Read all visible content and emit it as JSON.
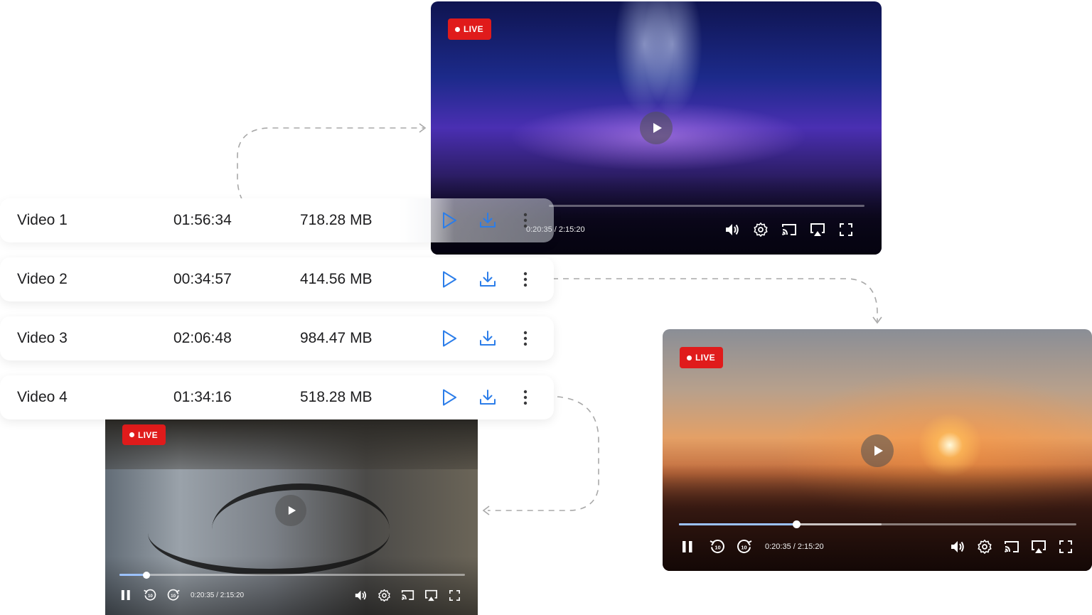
{
  "videos": [
    {
      "name": "Video 1",
      "duration": "01:56:34",
      "size": "718.28 MB"
    },
    {
      "name": "Video 2",
      "duration": "00:34:57",
      "size": "414.56 MB"
    },
    {
      "name": "Video 3",
      "duration": "02:06:48",
      "size": "984.47 MB"
    },
    {
      "name": "Video 4",
      "duration": "01:34:16",
      "size": "518.28 MB"
    }
  ],
  "players": {
    "concert": {
      "live_label": "LIVE",
      "time": "0:20:35 / 2:15:20",
      "progress_visible": false
    },
    "sunset": {
      "live_label": "LIVE",
      "time": "0:20:35 / 2:15:20",
      "progress_fraction": 0.295,
      "buffer_fraction": 0.51
    },
    "workout": {
      "live_label": "LIVE",
      "time": "0:20:35 / 2:15:20",
      "progress_fraction": 0.078
    }
  },
  "icons": {
    "row_actions": [
      "play-icon",
      "download-icon",
      "more-vertical-icon"
    ],
    "player_controls": [
      "pause-icon",
      "rewind-10-icon",
      "forward-10-icon",
      "volume-icon",
      "settings-icon",
      "cast-icon",
      "airplay-icon",
      "fullscreen-icon"
    ]
  },
  "colors": {
    "accent": "#2b7de9",
    "live": "#e01b1b",
    "progress": "#9cc2ff"
  }
}
